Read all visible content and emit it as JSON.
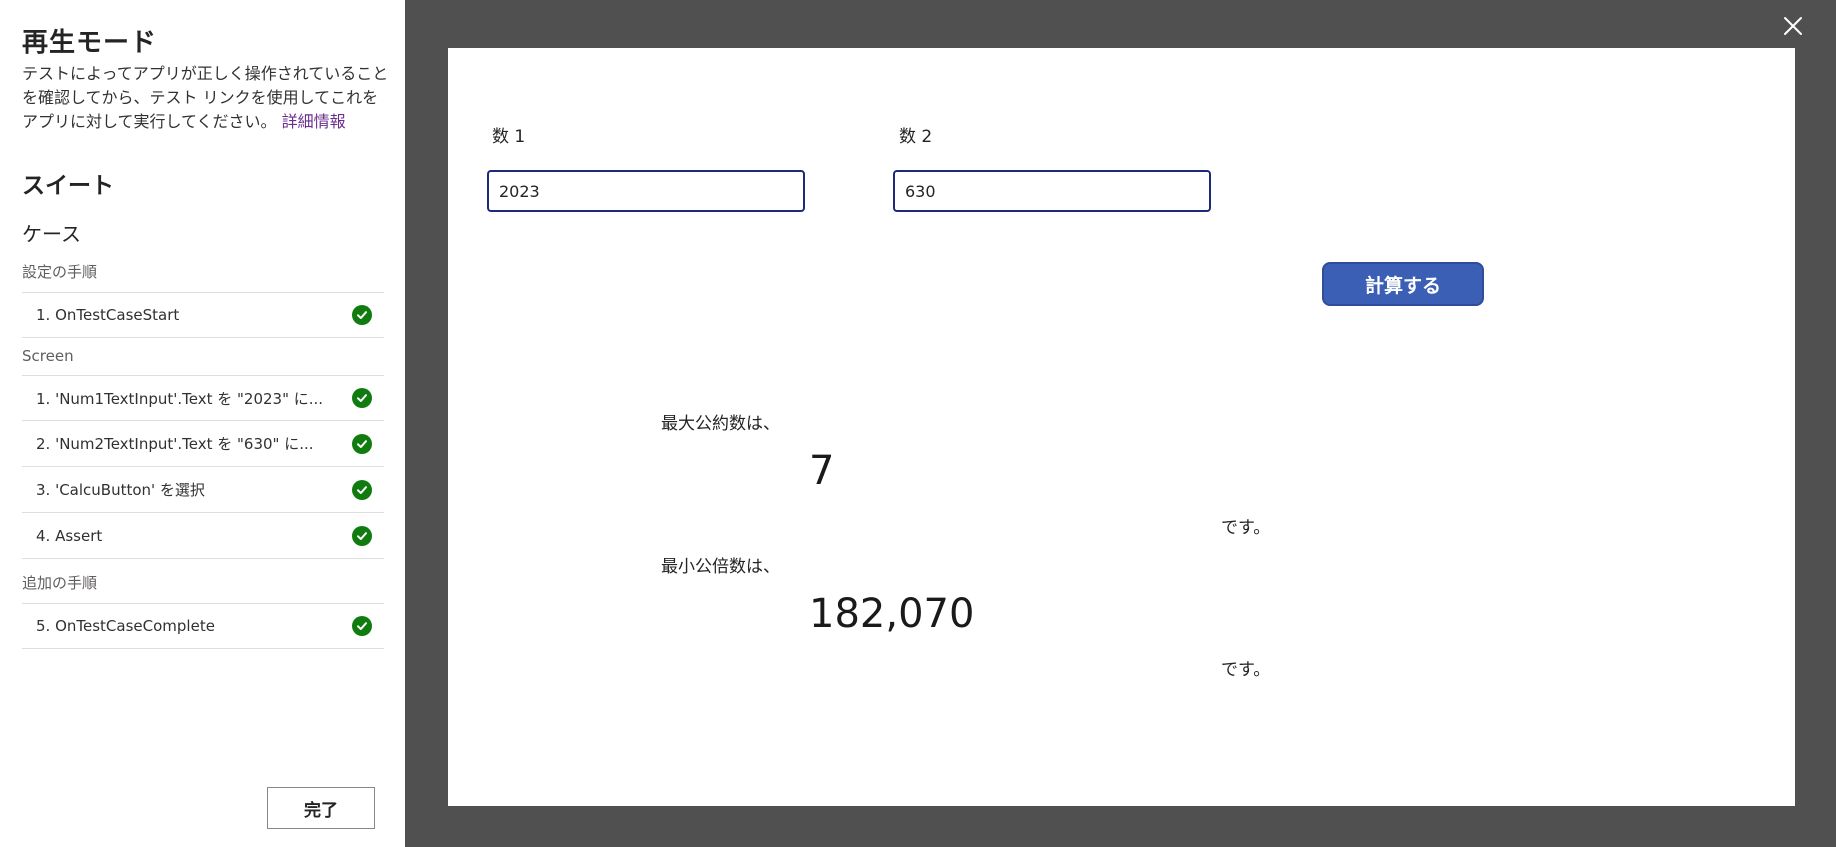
{
  "panel": {
    "title": "再生モード",
    "description": "テストによってアプリが正しく操作されていることを確認してから、テスト リンクを使用してこれをアプリに対して実行してください。",
    "more_link": "詳細情報",
    "suite_title": "スイート",
    "case_title": "ケース",
    "groups": {
      "setup": {
        "label": "設定の手順",
        "steps": [
          {
            "text": "1.  OnTestCaseStart",
            "status": "passed"
          }
        ]
      },
      "screen": {
        "label": "Screen",
        "steps": [
          {
            "text": "1.  'Num1TextInput'.Text を \"2023\" に...",
            "status": "passed"
          },
          {
            "text": "2.  'Num2TextInput'.Text を \"630\" に...",
            "status": "passed"
          },
          {
            "text": "3.  'CalcuButton' を選択",
            "status": "passed"
          },
          {
            "text": "4.  Assert",
            "status": "passed"
          }
        ]
      },
      "additional": {
        "label": "追加の手順",
        "steps": [
          {
            "text": "5.  OnTestCaseComplete",
            "status": "passed"
          }
        ]
      }
    },
    "done_label": "完了"
  },
  "app": {
    "num1": {
      "label": "数 1",
      "value": "2023"
    },
    "num2": {
      "label": "数 2",
      "value": "630"
    },
    "calc_label": "計算する",
    "gcd_label": "最大公約数は、",
    "gcd_value": "7",
    "lcm_label": "最小公倍数は、",
    "lcm_value": "182,070",
    "suffix": "です。"
  },
  "colors": {
    "check": "#107c10",
    "button": "#3a5fb5",
    "stage_bg": "#505050",
    "link": "#6b2f8e"
  },
  "icons": {
    "close": "close-icon",
    "check": "checkmark-circle-icon"
  }
}
